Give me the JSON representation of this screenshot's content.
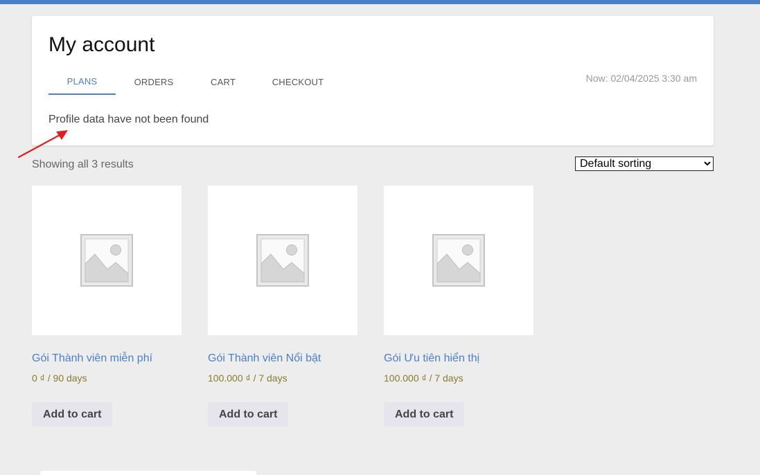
{
  "account": {
    "title": "My account",
    "tabs": [
      {
        "label": "PLANS",
        "active": true
      },
      {
        "label": "ORDERS"
      },
      {
        "label": "CART"
      },
      {
        "label": "CHECKOUT"
      }
    ],
    "now": "Now: 02/04/2025 3:30 am",
    "profile_message": "Profile data have not been found"
  },
  "shop": {
    "results": "Showing all 3 results",
    "sort": {
      "selected": "Default sorting",
      "options": [
        "Default sorting"
      ]
    },
    "products": [
      {
        "title": "Gói Thành viên miễn phí",
        "price": "0 ₫ / 90 days",
        "button": "Add to cart",
        "image": "placeholder-image-icon"
      },
      {
        "title": "Gói Thành viên Nổi bật",
        "price": "100.000 ₫ / 7 days",
        "button": "Add to cart",
        "image": "placeholder-image-icon"
      },
      {
        "title": "Gói Ưu tiên hiển thị",
        "price": "100.000 ₫ / 7 days",
        "button": "Add to cart",
        "image": "placeholder-image-icon"
      }
    ]
  },
  "colors": {
    "accent": "#4a80c8",
    "price": "#8a7a2a",
    "annotation_arrow": "#e02020",
    "background": "#ededed"
  }
}
